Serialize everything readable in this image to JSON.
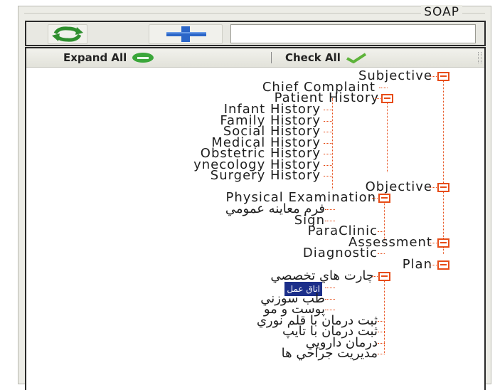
{
  "panel": {
    "title": "SOAP"
  },
  "toolbar": {
    "refresh_icon": "refresh-arrows-icon",
    "add_icon": "plus-icon",
    "search_value": ""
  },
  "tree_toolbar": {
    "expand_all": "Expand All",
    "check_all": "Check All",
    "expand_icon_color": "#3aa63a",
    "check_icon_color": "#5db33a"
  },
  "tree": {
    "line_color": "#e74c17",
    "nodes": {
      "subjective": "Subjective",
      "chief_complaint": "Chief Complaint",
      "patient_history": "Patient History",
      "infant_history": "Infant History",
      "family_history": "Family History",
      "social_history": "Social History",
      "medical_history": "Medical History",
      "obstetric_history": "Obstetric History",
      "gynecology_history": "ynecology History",
      "surgery_history": "Surgery History",
      "objective": "Objective",
      "physical_examination": "Physical Examination",
      "general_exam_form": "فرم معاينه عمومي",
      "sign": "Sign",
      "paraclinic": "ParaClinic",
      "assessment": "Assessment",
      "diagnostic": "Diagnostic",
      "plan": "Plan",
      "specialty_charts": "چارت هاي تخصصي",
      "selected_item": "اتاق عمل",
      "acupuncture": "طب سوزني",
      "skin_hair": "پوست و مو",
      "light_pen_therapy": "ثبت درمان با قلم نوري",
      "tape_therapy": "ثبت درمان با تايپ",
      "drug_therapy": "درمان دارويي",
      "surgery_management": "مديريت جراحي ها"
    }
  }
}
